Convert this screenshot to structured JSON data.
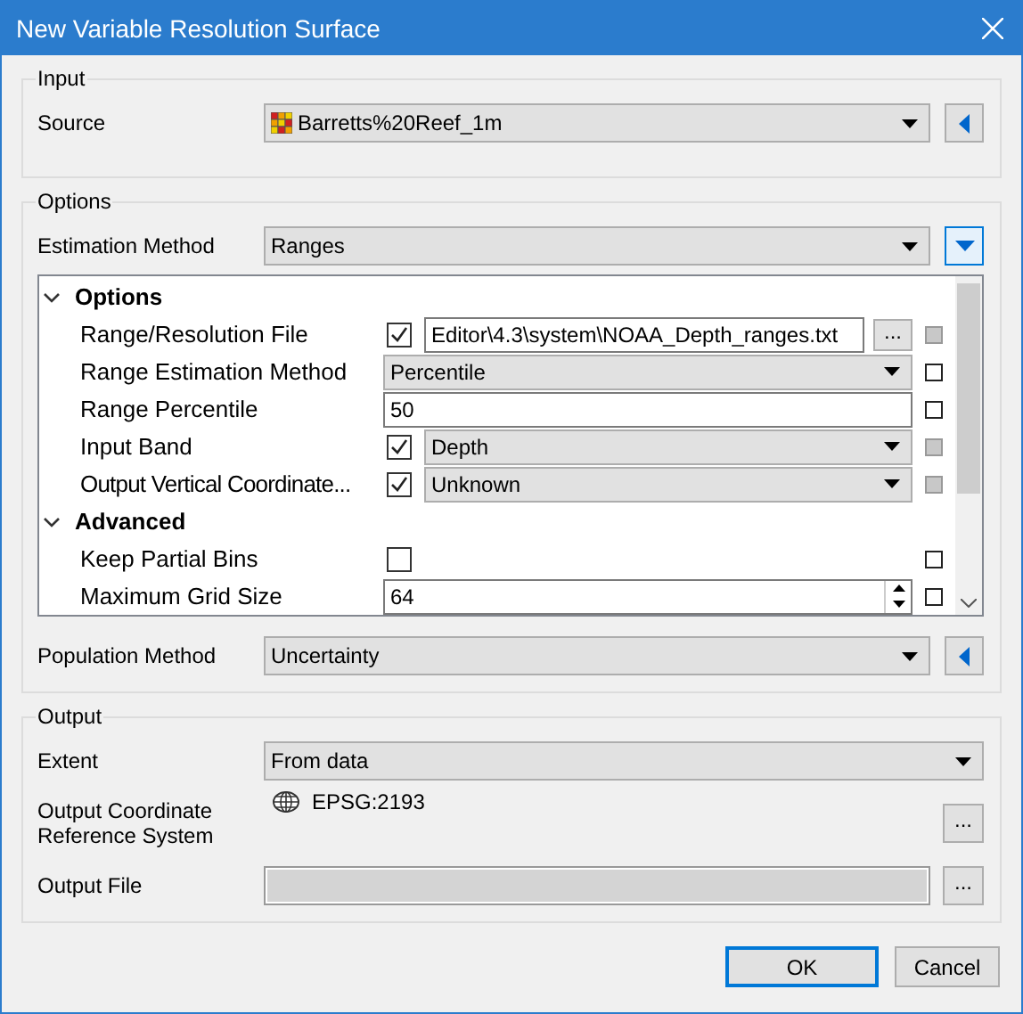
{
  "window": {
    "title": "New Variable Resolution Surface"
  },
  "input": {
    "title": "Input",
    "source": {
      "label": "Source",
      "value": "Barretts%20Reef_1m",
      "expanded": false
    }
  },
  "options": {
    "title": "Options",
    "estimation_method": {
      "label": "Estimation Method",
      "value": "Ranges",
      "expanded": true
    },
    "grid": {
      "sections": [
        {
          "title": "Options",
          "expanded": true,
          "rows": [
            {
              "kind": "file",
              "label": "Range/Resolution File",
              "checked": true,
              "value": "Editor\\4.3\\system\\NOAA_Depth_ranges.txt",
              "button": "...",
              "marker_filled": true
            },
            {
              "kind": "combo",
              "label": "Range Estimation Method",
              "value": "Percentile",
              "marker_filled": false
            },
            {
              "kind": "text",
              "label": "Range Percentile",
              "value": "50",
              "marker_filled": false
            },
            {
              "kind": "check_combo",
              "label": "Input Band",
              "checked": true,
              "value": "Depth",
              "marker_filled": true
            },
            {
              "kind": "check_combo",
              "label": "Output Vertical Coordinate...",
              "checked": true,
              "value": "Unknown",
              "marker_filled": true
            }
          ]
        },
        {
          "title": "Advanced",
          "expanded": true,
          "rows": [
            {
              "kind": "check",
              "label": "Keep Partial Bins",
              "checked": false,
              "marker_filled": false
            },
            {
              "kind": "spin",
              "label": "Maximum Grid Size",
              "value": "64",
              "marker_filled": false
            }
          ]
        }
      ]
    },
    "population_method": {
      "label": "Population Method",
      "value": "Uncertainty",
      "expanded": false
    }
  },
  "output": {
    "title": "Output",
    "extent": {
      "label": "Extent",
      "value": "From data"
    },
    "crs": {
      "label": "Output Coordinate Reference System",
      "value": "EPSG:2193",
      "button": "..."
    },
    "file": {
      "label": "Output File",
      "disabled": true,
      "button": "..."
    }
  },
  "buttons": [
    {
      "label": "OK",
      "default": true
    },
    {
      "label": "Cancel",
      "default": false
    }
  ]
}
